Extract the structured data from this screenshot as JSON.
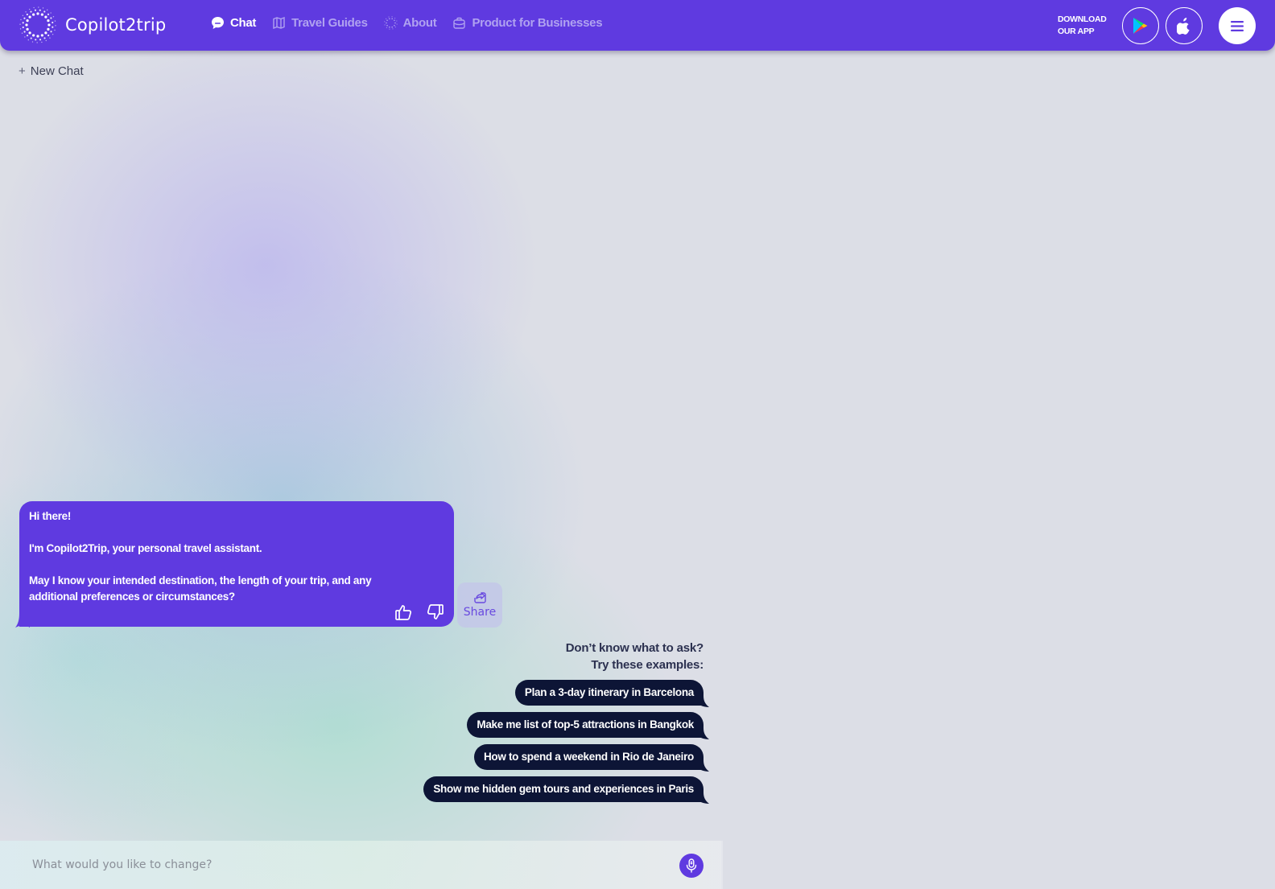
{
  "colors": {
    "brand": "#5f3ae0",
    "chip_bg": "#0d1536",
    "nav_inactive": "#b0a2f0",
    "text_dark": "#2c3150"
  },
  "header": {
    "brand_name": "Copilot2trip",
    "logo_icon": "sunburst-dots-icon",
    "nav": [
      {
        "label": "Chat",
        "icon": "chat-bubble-icon",
        "active": true
      },
      {
        "label": "Travel Guides",
        "icon": "map-icon",
        "active": false
      },
      {
        "label": "About",
        "icon": "dotted-circle-icon",
        "active": false
      },
      {
        "label": "Product for Businesses",
        "icon": "briefcase-icon",
        "active": false
      }
    ],
    "download_line1": "DOWNLOAD",
    "download_line2": "OUR APP",
    "store_buttons": [
      {
        "name": "google-play",
        "icon": "google-play-icon"
      },
      {
        "name": "app-store",
        "icon": "apple-icon"
      }
    ],
    "menu_icon": "hamburger-icon"
  },
  "sidebar": {
    "new_chat_label": "New Chat",
    "new_chat_icon": "plus-icon"
  },
  "chat": {
    "bot_message": {
      "lines": [
        "Hi there!",
        "I'm Copilot2Trip, your personal travel assistant.",
        "May I know your intended destination, the length of your trip, and any additional preferences or circumstances?"
      ],
      "like_icon": "thumbs-up-icon",
      "dislike_icon": "thumbs-down-icon"
    },
    "share_label": "Share",
    "share_icon": "share-icon"
  },
  "suggestions": {
    "heading_line1": "Don’t know what to ask?",
    "heading_line2": "Try these examples:",
    "items": [
      "Plan a 3-day itinerary in Barcelona",
      "Make me list of top-5 attractions in Bangkok",
      "How to spend a weekend in Rio de Janeiro",
      "Show me hidden gem tours and experiences in Paris"
    ]
  },
  "composer": {
    "placeholder": "What would you like to change?",
    "value": "",
    "mic_icon": "microphone-icon"
  }
}
